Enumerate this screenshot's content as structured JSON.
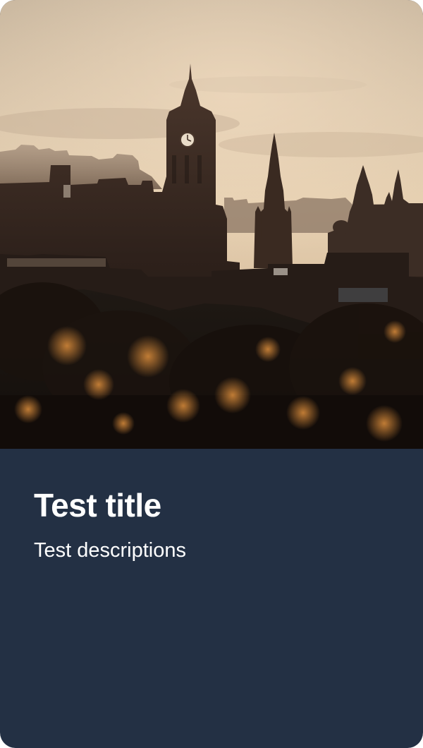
{
  "card": {
    "title": "Test title",
    "description": "Test descriptions",
    "image_subject": "city-skyline-at-sunset-photo"
  },
  "colors": {
    "card_background": "#233044",
    "text": "#ffffff",
    "sky_top": "#d9c7ae",
    "sky_horizon": "#e8d2b4",
    "silhouette": "#2a1d17",
    "foliage_glow": "#b86b25"
  }
}
